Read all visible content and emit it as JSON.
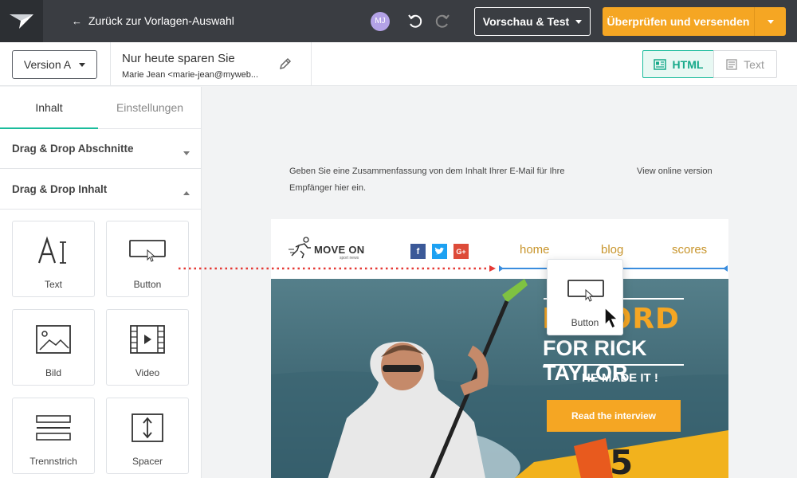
{
  "topbar": {
    "back_label": "Zurück zur Vorlagen-Auswahl",
    "avatar_initials": "MJ",
    "preview_label": "Vorschau & Test",
    "send_label": "Überprüfen und versenden",
    "accent_color": "#f5a623"
  },
  "subbar": {
    "version_label": "Version A",
    "subject": "Nur heute sparen Sie",
    "sender": "Marie Jean <marie-jean@myweb...",
    "mode_html": "HTML",
    "mode_text": "Text"
  },
  "sidebar": {
    "tabs": [
      {
        "label": "Inhalt",
        "active": true
      },
      {
        "label": "Einstellungen",
        "active": false
      }
    ],
    "sections": [
      {
        "label": "Drag & Drop Abschnitte",
        "expanded": false
      },
      {
        "label": "Drag & Drop Inhalt",
        "expanded": true
      }
    ],
    "blocks": [
      {
        "label": "Text",
        "icon": "text-icon"
      },
      {
        "label": "Button",
        "icon": "button-icon"
      },
      {
        "label": "Bild",
        "icon": "image-icon"
      },
      {
        "label": "Video",
        "icon": "video-icon"
      },
      {
        "label": "Trennstrich",
        "icon": "divider-icon"
      },
      {
        "label": "Spacer",
        "icon": "spacer-icon"
      }
    ]
  },
  "canvas": {
    "preheader": "Geben Sie eine Zusammenfassung von dem Inhalt Ihrer E-Mail für Ihre Empfänger hier ein.",
    "view_online": "View online version",
    "email": {
      "brand_name": "MOVE ON",
      "brand_sub": "sport news",
      "social": [
        "f",
        "t",
        "G+"
      ],
      "nav": [
        "home",
        "blog",
        "scores"
      ],
      "hero_title1": "RECORD",
      "hero_title2": "FOR RICK TAYLOR",
      "hero_title3": "HE MADE IT !",
      "hero_cta": "Read the interview"
    },
    "drag_ghost_label": "Button"
  }
}
